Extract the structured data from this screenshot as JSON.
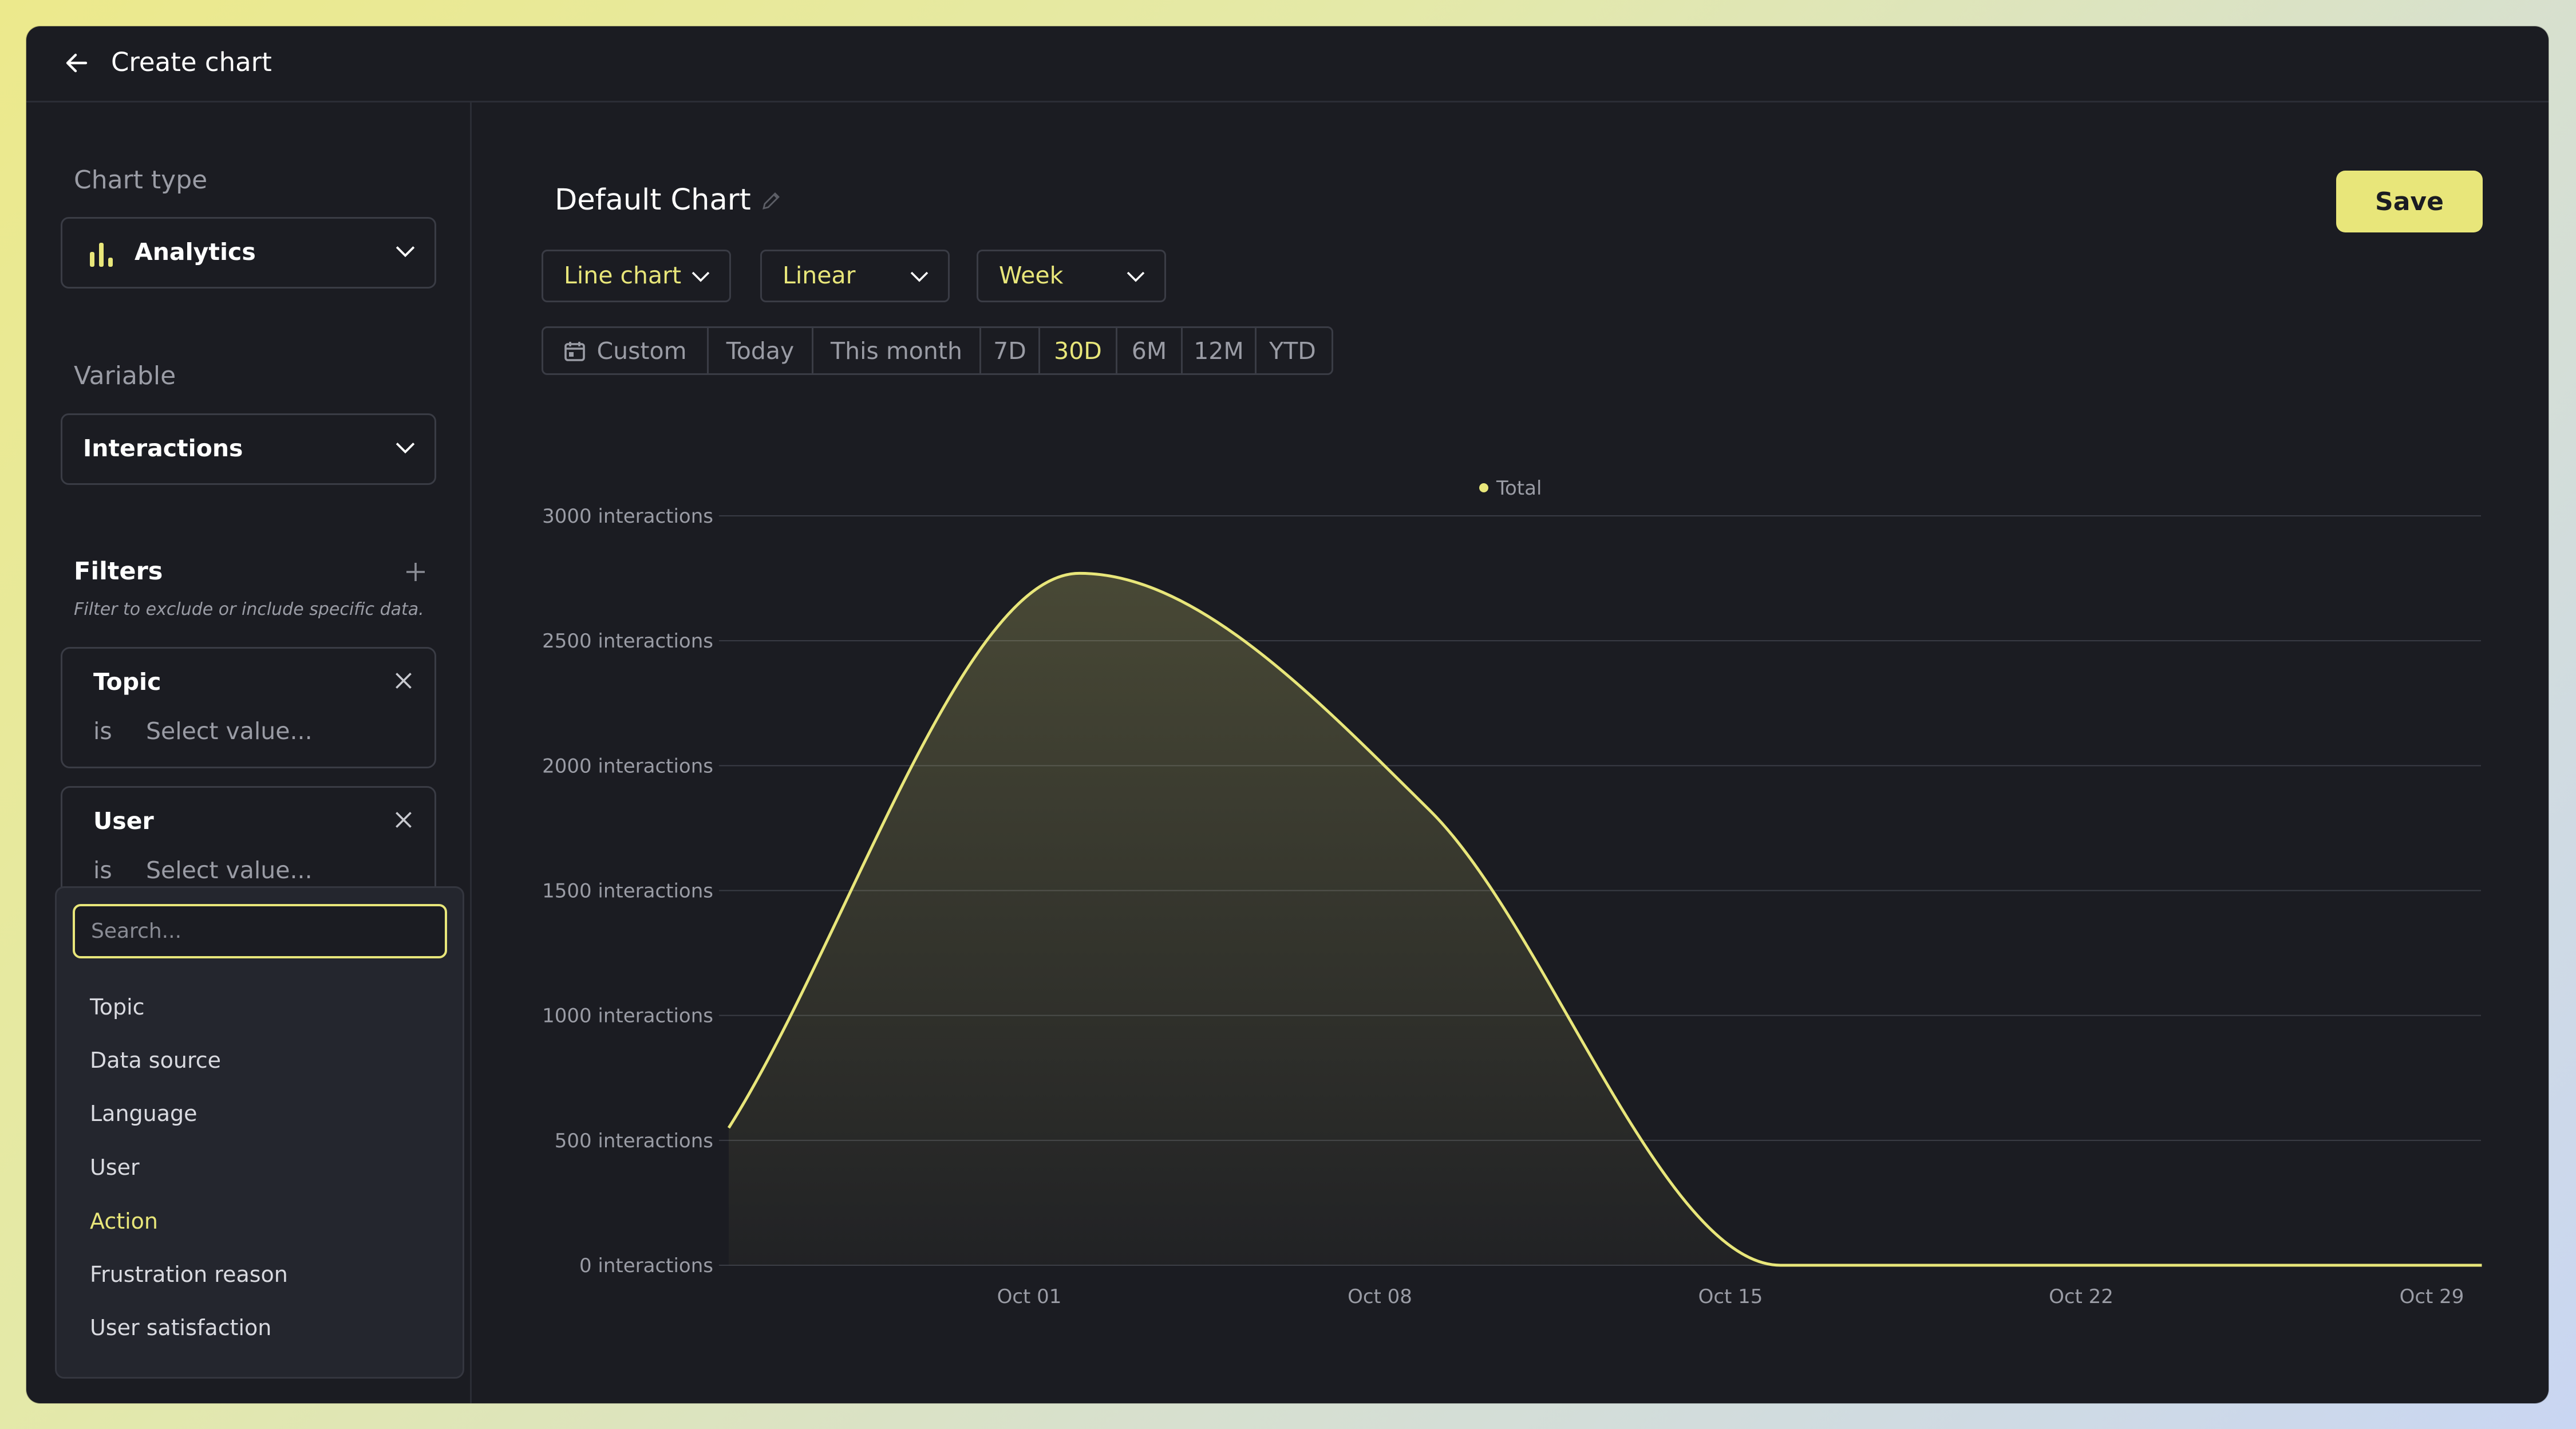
{
  "header": {
    "title": "Create chart"
  },
  "sidebar": {
    "chart_type_label": "Chart type",
    "chart_type_value": "Analytics",
    "variable_label": "Variable",
    "variable_value": "Interactions",
    "filters_title": "Filters",
    "filters_subtitle": "Filter to exclude or include specific data.",
    "filters": [
      {
        "name": "Topic",
        "operator": "is",
        "placeholder": "Select value..."
      },
      {
        "name": "User",
        "operator": "is",
        "placeholder": "Select value..."
      }
    ],
    "dropdown": {
      "search_placeholder": "Search...",
      "items": [
        "Topic",
        "Data source",
        "Language",
        "User",
        "Action",
        "Frustration reason",
        "User satisfaction"
      ],
      "active_item": "Action"
    }
  },
  "main": {
    "chart_title": "Default Chart",
    "save_label": "Save",
    "chart_type_select": "Line chart",
    "scale_select": "Linear",
    "interval_select": "Week",
    "ranges": [
      "Custom",
      "Today",
      "This month",
      "7D",
      "30D",
      "6M",
      "12M",
      "YTD"
    ],
    "active_range": "30D"
  },
  "colors": {
    "accent": "#e8e67a",
    "background": "#1b1c22",
    "panel": "#24262e"
  },
  "chart_data": {
    "type": "area",
    "legend": [
      "Total"
    ],
    "legend_position": "top-center",
    "x_ticks": [
      "Oct 01",
      "Oct 08",
      "Oct 15",
      "Oct 22",
      "Oct 29"
    ],
    "y_ticks": [
      "0 interactions",
      "500 interactions",
      "1000 interactions",
      "1500 interactions",
      "2000 interactions",
      "2500 interactions",
      "3000 interactions"
    ],
    "ylim": [
      0,
      3000
    ],
    "grid": true,
    "series": [
      {
        "name": "Total",
        "color": "#e8e67a",
        "x": [
          "Sep 25",
          "Oct 02",
          "Oct 09",
          "Oct 16",
          "Oct 23",
          "Oct 30"
        ],
        "values": [
          550,
          2770,
          1820,
          0,
          0,
          0
        ]
      }
    ]
  }
}
